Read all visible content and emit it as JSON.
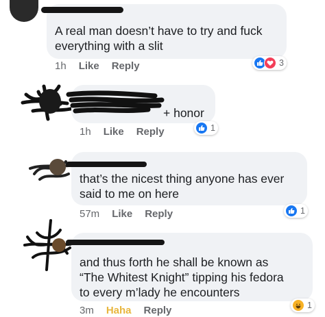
{
  "comments": [
    {
      "text": "A real man doesn’t have to try and fuck\neverything with a slit",
      "time": "1h",
      "actions": [
        "Like",
        "Reply"
      ],
      "reactions": {
        "types": [
          "like-icon",
          "love-icon"
        ],
        "count": "3"
      }
    },
    {
      "text": "+ honor",
      "time": "1h",
      "actions": [
        "Like",
        "Reply"
      ],
      "reactions": {
        "types": [
          "like-icon"
        ],
        "count": "1"
      }
    },
    {
      "text": "that’s the nicest thing anyone has ever\nsaid to me on here",
      "time": "57m",
      "actions": [
        "Like",
        "Reply"
      ],
      "reactions": {
        "types": [
          "like-icon"
        ],
        "count": "1"
      }
    },
    {
      "text": "and thus forth he shall be known as\n“The Whitest Knight” tipping his fedora\nto every m’lady he encounters",
      "time": "3m",
      "actions": [
        "Haha",
        "Reply"
      ],
      "reactions": {
        "types": [
          "haha-icon"
        ],
        "count": "1"
      }
    }
  ],
  "colors": {
    "bubble": "#f0f2f5",
    "meta": "#65676b",
    "like_blue": "#1877f2",
    "love_red": "#f33e58",
    "haha_yellow": "#f7b125"
  }
}
